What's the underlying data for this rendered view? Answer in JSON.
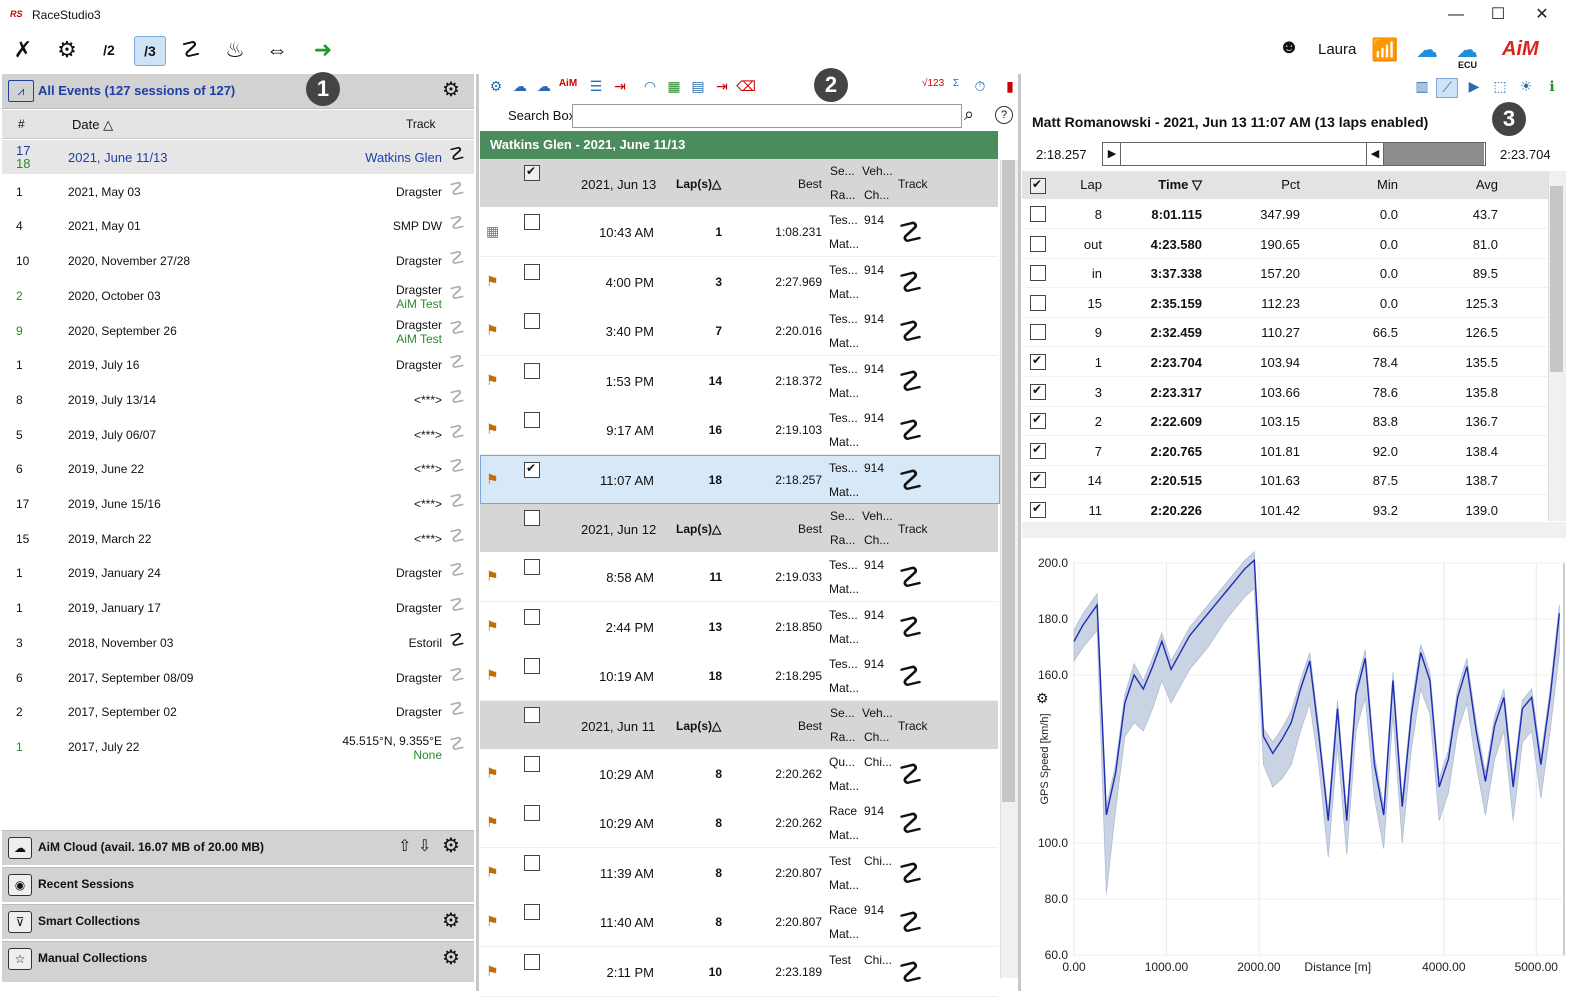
{
  "window": {
    "title": "RaceStudio3",
    "minimize": "—",
    "maximize": "☐",
    "close": "✕"
  },
  "toolbar": {
    "user_name": "Laura",
    "ecu_label": "ECU",
    "brand": "AiM"
  },
  "left": {
    "events_title": "All Events (127 sessions of 127)",
    "badge": "1",
    "col_num": "#",
    "col_date": "Date △",
    "col_track": "Track",
    "rows": [
      {
        "num": "17",
        "num2": "18",
        "date": "2021, June 11/13",
        "track": "Watkins Glen",
        "track2": ""
      },
      {
        "num": "1",
        "date": "2021, May 03",
        "track": "Dragster",
        "track2": ""
      },
      {
        "num": "4",
        "date": "2021, May 01",
        "track": "SMP DW",
        "track2": ""
      },
      {
        "num": "10",
        "date": "2020, November 27/28",
        "track": "Dragster",
        "track2": ""
      },
      {
        "num": "2",
        "date": "2020, October 03",
        "track": "Dragster",
        "track2": "AiM Test"
      },
      {
        "num": "9",
        "date": "2020, September 26",
        "track": "Dragster",
        "track2": "AiM Test"
      },
      {
        "num": "1",
        "date": "2019, July 16",
        "track": "Dragster",
        "track2": ""
      },
      {
        "num": "8",
        "date": "2019, July 13/14",
        "track": "<***>",
        "track2": ""
      },
      {
        "num": "5",
        "date": "2019, July 06/07",
        "track": "<***>",
        "track2": ""
      },
      {
        "num": "6",
        "date": "2019, June 22",
        "track": "<***>",
        "track2": ""
      },
      {
        "num": "17",
        "date": "2019, June 15/16",
        "track": "<***>",
        "track2": ""
      },
      {
        "num": "15",
        "date": "2019, March 22",
        "track": "<***>",
        "track2": ""
      },
      {
        "num": "1",
        "date": "2019, January 24",
        "track": "Dragster",
        "track2": ""
      },
      {
        "num": "1",
        "date": "2019, January 17",
        "track": "Dragster",
        "track2": ""
      },
      {
        "num": "3",
        "date": "2018, November 03",
        "track": "Estoril",
        "track2": ""
      },
      {
        "num": "6",
        "date": "2017, September 08/09",
        "track": "Dragster",
        "track2": ""
      },
      {
        "num": "2",
        "date": "2017, September 02",
        "track": "Dragster",
        "track2": ""
      },
      {
        "num": "1",
        "date": "2017, July 22",
        "track": "45.515°N, 9.355°E",
        "track2": "None"
      }
    ],
    "cloud": "AiM Cloud (avail. 16.07 MB of 20.00 MB)",
    "recent": "Recent Sessions",
    "smart": "Smart Collections",
    "manual": "Manual Collections"
  },
  "middle": {
    "badge": "2",
    "search_label": "Search Box",
    "search_value": "",
    "header": "Watkins Glen - 2021, June 11/13",
    "laps_col": "Lap(s)△",
    "best_col": "Best",
    "se_col": "Se...",
    "ra_col": "Ra...",
    "veh_col": "Veh...",
    "ch_col": "Ch...",
    "track_col": "Track",
    "groups": [
      {
        "date": "2021, Jun 13",
        "sessions": [
          {
            "time": "10:43 AM",
            "laps": "1",
            "best": "1:08.231",
            "se": "Tes...",
            "ra": "Mat...",
            "veh": "914",
            "checked": false
          },
          {
            "time": "4:00 PM",
            "laps": "3",
            "best": "2:27.969",
            "se": "Tes...",
            "ra": "Mat...",
            "veh": "914",
            "checked": false
          },
          {
            "time": "3:40 PM",
            "laps": "7",
            "best": "2:20.016",
            "se": "Tes...",
            "ra": "Mat...",
            "veh": "914",
            "checked": false
          },
          {
            "time": "1:53 PM",
            "laps": "14",
            "best": "2:18.372",
            "se": "Tes...",
            "ra": "Mat...",
            "veh": "914",
            "checked": false
          },
          {
            "time": "9:17 AM",
            "laps": "16",
            "best": "2:19.103",
            "se": "Tes...",
            "ra": "Mat...",
            "veh": "914",
            "checked": false
          },
          {
            "time": "11:07 AM",
            "laps": "18",
            "best": "2:18.257",
            "se": "Tes...",
            "ra": "Mat...",
            "veh": "914",
            "checked": true
          }
        ]
      },
      {
        "date": "2021, Jun 12",
        "sessions": [
          {
            "time": "8:58 AM",
            "laps": "11",
            "best": "2:19.033",
            "se": "Tes...",
            "ra": "Mat...",
            "veh": "914",
            "checked": false
          },
          {
            "time": "2:44 PM",
            "laps": "13",
            "best": "2:18.850",
            "se": "Tes...",
            "ra": "Mat...",
            "veh": "914",
            "checked": false
          },
          {
            "time": "10:19 AM",
            "laps": "18",
            "best": "2:18.295",
            "se": "Tes...",
            "ra": "Mat...",
            "veh": "914",
            "checked": false
          }
        ]
      },
      {
        "date": "2021, Jun 11",
        "sessions": [
          {
            "time": "10:29 AM",
            "laps": "8",
            "best": "2:20.262",
            "se": "Qu...",
            "ra": "Mat...",
            "veh": "Chi...",
            "checked": false
          },
          {
            "time": "10:29 AM",
            "laps": "8",
            "best": "2:20.262",
            "se": "Race",
            "ra": "Mat...",
            "veh": "914",
            "checked": false
          },
          {
            "time": "11:39 AM",
            "laps": "8",
            "best": "2:20.807",
            "se": "Test",
            "ra": "Mat...",
            "veh": "Chi...",
            "checked": false
          },
          {
            "time": "11:40 AM",
            "laps": "8",
            "best": "2:20.807",
            "se": "Race",
            "ra": "Mat...",
            "veh": "914",
            "checked": false
          },
          {
            "time": "2:11 PM",
            "laps": "10",
            "best": "2:23.189",
            "se": "Test",
            "ra": "",
            "veh": "Chi...",
            "checked": false
          }
        ]
      }
    ]
  },
  "right": {
    "badge": "3",
    "title": "Matt Romanowski - 2021, Jun 13 11:07 AM (13 laps enabled)",
    "slider_left": "2:18.257",
    "slider_right": "2:23.704",
    "cols": {
      "lap": "Lap",
      "time": "Time ▽",
      "pct": "Pct",
      "min": "Min",
      "avg": "Avg"
    },
    "laps": [
      {
        "lap": "8",
        "time": "8:01.115",
        "pct": "347.99",
        "min": "0.0",
        "avg": "43.7",
        "checked": false
      },
      {
        "lap": "out",
        "time": "4:23.580",
        "pct": "190.65",
        "min": "0.0",
        "avg": "81.0",
        "checked": false
      },
      {
        "lap": "in",
        "time": "3:37.338",
        "pct": "157.20",
        "min": "0.0",
        "avg": "89.5",
        "checked": false
      },
      {
        "lap": "15",
        "time": "2:35.159",
        "pct": "112.23",
        "min": "0.0",
        "avg": "125.3",
        "checked": false
      },
      {
        "lap": "9",
        "time": "2:32.459",
        "pct": "110.27",
        "min": "66.5",
        "avg": "126.5",
        "checked": false
      },
      {
        "lap": "1",
        "time": "2:23.704",
        "pct": "103.94",
        "min": "78.4",
        "avg": "135.5",
        "checked": true
      },
      {
        "lap": "3",
        "time": "2:23.317",
        "pct": "103.66",
        "min": "78.6",
        "avg": "135.8",
        "checked": true
      },
      {
        "lap": "2",
        "time": "2:22.609",
        "pct": "103.15",
        "min": "83.8",
        "avg": "136.7",
        "checked": true
      },
      {
        "lap": "7",
        "time": "2:20.765",
        "pct": "101.81",
        "min": "92.0",
        "avg": "138.4",
        "checked": true
      },
      {
        "lap": "14",
        "time": "2:20.515",
        "pct": "101.63",
        "min": "87.5",
        "avg": "138.7",
        "checked": true
      },
      {
        "lap": "11",
        "time": "2:20.226",
        "pct": "101.42",
        "min": "93.2",
        "avg": "139.0",
        "checked": true
      }
    ]
  },
  "chart_data": {
    "type": "line",
    "title": "",
    "xlabel": "Distance [m]",
    "ylabel": "GPS Speed [km/h]",
    "xlim": [
      0,
      5300
    ],
    "ylim": [
      60,
      200
    ],
    "xticks": [
      "0.00",
      "1000.00",
      "2000.00",
      "4000.00",
      "5000.00"
    ],
    "xtick_values": [
      0,
      1000,
      2000,
      4000,
      5000
    ],
    "yticks": [
      "200.0",
      "180.0",
      "160.0",
      "100.0",
      "80.0",
      "60.0"
    ],
    "ytick_values": [
      200,
      180,
      160,
      100,
      80,
      60
    ],
    "series": [
      {
        "style": "line",
        "color": "#1f2db5",
        "x": [
          0,
          100,
          250,
          350,
          450,
          550,
          650,
          750,
          850,
          950,
          1050,
          1150,
          1250,
          1350,
          1450,
          1550,
          1650,
          1750,
          1850,
          1950,
          2050,
          2150,
          2250,
          2350,
          2450,
          2550,
          2650,
          2750,
          2850,
          2950,
          3050,
          3150,
          3250,
          3350,
          3450,
          3550,
          3650,
          3750,
          3850,
          3950,
          4050,
          4150,
          4250,
          4350,
          4450,
          4550,
          4650,
          4750,
          4850,
          4950,
          5050,
          5150,
          5250
        ],
        "y": [
          172,
          178,
          185,
          110,
          125,
          150,
          160,
          155,
          163,
          172,
          162,
          168,
          174,
          178,
          182,
          186,
          190,
          194,
          198,
          201,
          138,
          132,
          137,
          143,
          155,
          165,
          138,
          108,
          148,
          108,
          153,
          166,
          128,
          110,
          158,
          113,
          146,
          168,
          158,
          120,
          130,
          152,
          163,
          140,
          122,
          142,
          152,
          120,
          148,
          152,
          128,
          152,
          182
        ]
      },
      {
        "style": "band",
        "color": "#c9d3e3",
        "x": [
          0,
          100,
          250,
          350,
          450,
          550,
          650,
          750,
          850,
          950,
          1050,
          1150,
          1250,
          1350,
          1450,
          1550,
          1650,
          1750,
          1850,
          1950,
          2050,
          2150,
          2250,
          2350,
          2450,
          2550,
          2650,
          2750,
          2850,
          2950,
          3050,
          3150,
          3250,
          3350,
          3450,
          3550,
          3650,
          3750,
          3850,
          3950,
          4050,
          4150,
          4250,
          4350,
          4450,
          4550,
          4650,
          4750,
          4850,
          4950,
          5050,
          5150,
          5250
        ],
        "low": [
          165,
          170,
          176,
          82,
          112,
          138,
          143,
          140,
          148,
          158,
          150,
          156,
          162,
          166,
          170,
          175,
          180,
          184,
          188,
          191,
          128,
          120,
          123,
          128,
          140,
          150,
          127,
          95,
          135,
          96,
          140,
          152,
          116,
          98,
          146,
          100,
          134,
          155,
          146,
          108,
          118,
          140,
          150,
          128,
          110,
          130,
          140,
          108,
          136,
          140,
          116,
          140,
          168
        ],
        "high": [
          176,
          182,
          189,
          113,
          128,
          153,
          164,
          158,
          166,
          175,
          165,
          171,
          177,
          181,
          185,
          189,
          193,
          197,
          201,
          204,
          141,
          136,
          141,
          147,
          158,
          168,
          141,
          111,
          151,
          111,
          156,
          169,
          131,
          113,
          161,
          116,
          149,
          171,
          161,
          123,
          133,
          155,
          166,
          143,
          125,
          145,
          155,
          123,
          151,
          155,
          131,
          155,
          185
        ]
      }
    ]
  }
}
